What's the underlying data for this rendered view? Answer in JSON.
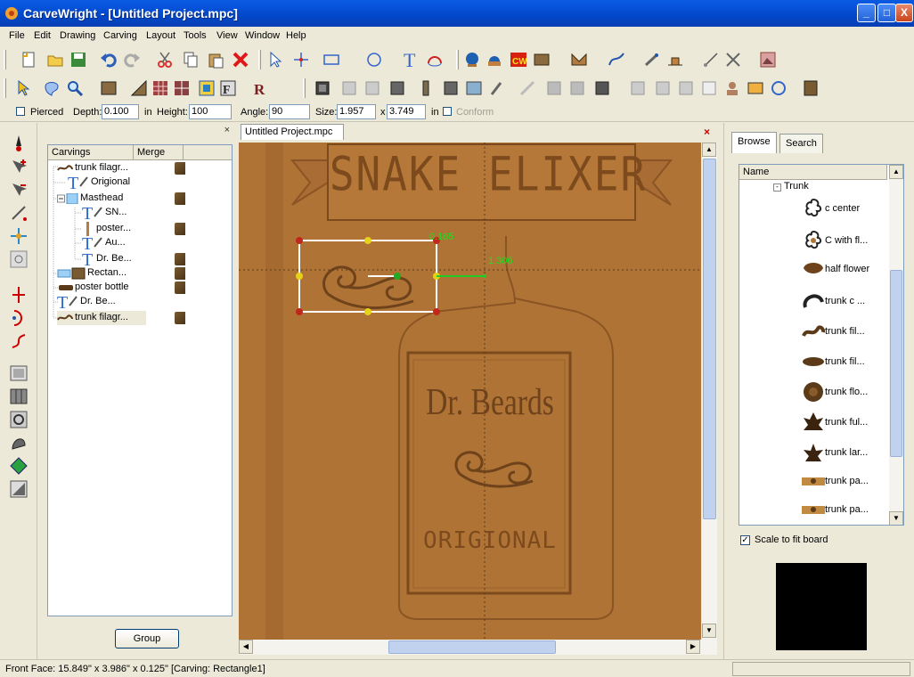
{
  "window": {
    "title": "CarveWright - [Untitled Project.mpc]",
    "controls": {
      "minimize": "_",
      "maximize": "□",
      "close": "X"
    }
  },
  "menu": [
    "File",
    "Edit",
    "Drawing",
    "Carving",
    "Layout",
    "Tools",
    "View",
    "Window",
    "Help"
  ],
  "options": {
    "pierced_label": "Pierced",
    "depth_label": "Depth:",
    "depth_value": "0.100",
    "depth_unit": "in",
    "height_label": "Height:",
    "height_value": "100",
    "angle_label": "Angle:",
    "angle_value": "90",
    "size_label": "Size:",
    "size_w": "1.957",
    "size_x": "x",
    "size_h": "3.749",
    "size_unit": "in",
    "conform_label": "Conform"
  },
  "carvings_panel": {
    "col_carvings": "Carvings",
    "col_merge": "Merge",
    "close": "×",
    "items": [
      {
        "label": "trunk filagr...",
        "icon": "filigree-icon",
        "merge": true
      },
      {
        "label": "Origional",
        "icon": "text-icon",
        "merge": false
      },
      {
        "label": "Masthead",
        "icon": "group-icon",
        "merge": true
      },
      {
        "label": "SN...",
        "icon": "text-icon",
        "merge": false
      },
      {
        "label": "poster...",
        "icon": "line-icon",
        "merge": true
      },
      {
        "label": "Au...",
        "icon": "text-icon",
        "merge": false
      },
      {
        "label": "Dr. Be...",
        "icon": "text-icon",
        "merge": true
      },
      {
        "label": "Rectan...",
        "icon": "rectangle-icon",
        "merge": true
      },
      {
        "label": "poster bottle",
        "icon": "bottle-icon",
        "merge": true
      },
      {
        "label": "Dr. Be...",
        "icon": "text-icon",
        "merge": false
      },
      {
        "label": "trunk filagr...",
        "icon": "filigree-icon",
        "merge": true
      }
    ],
    "group_button": "Group"
  },
  "document": {
    "tab": "Untitled Project.mpc",
    "close": "×",
    "sign_text": "SNAKE ELIXER",
    "label_top": "Dr. Beards",
    "label_bottom": "ORIGIONAL",
    "dim_width": "0.165",
    "dim_offset": "1.306"
  },
  "browse_panel": {
    "tabs": [
      "Browse",
      "Search"
    ],
    "col_name": "Name",
    "folder": "Trunk",
    "items": [
      {
        "label": "c center"
      },
      {
        "label": "C with fl..."
      },
      {
        "label": "half flower"
      },
      {
        "label": "trunk c ..."
      },
      {
        "label": "trunk fil..."
      },
      {
        "label": "trunk fil..."
      },
      {
        "label": "trunk flo..."
      },
      {
        "label": "trunk ful..."
      },
      {
        "label": "trunk lar..."
      },
      {
        "label": "trunk pa..."
      },
      {
        "label": "trunk pa..."
      }
    ],
    "scale_label": "Scale to fit board",
    "scale_checked": true
  },
  "status": {
    "text": "Front Face: 15.849\" x 3.986\" x 0.125\"  [Carving: Rectangle1]"
  },
  "colors": {
    "board": "#b07336",
    "selection": "#ffffff",
    "handle_corner": "#c0281c",
    "handle_mid": "#e6d21a",
    "dimension": "#22cc22"
  }
}
